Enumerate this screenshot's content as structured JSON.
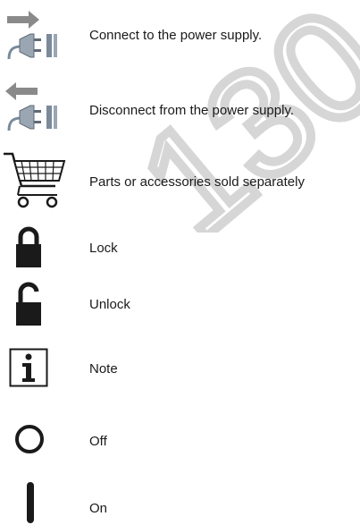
{
  "watermark": {
    "text": "130",
    "color": "#d6d6d6"
  },
  "colors": {
    "ink": "#1a1a1a",
    "arrow": "#8a8a8a",
    "plug": "#7a8a9a"
  },
  "symbols": [
    {
      "icon": "plug-connect-icon",
      "label": "Connect to the power supply."
    },
    {
      "icon": "plug-disconnect-icon",
      "label": "Disconnect from the power supply."
    },
    {
      "icon": "shopping-cart-icon",
      "label": "Parts or accessories sold separately"
    },
    {
      "icon": "lock-icon",
      "label": "Lock"
    },
    {
      "icon": "unlock-icon",
      "label": "Unlock"
    },
    {
      "icon": "info-icon",
      "label": "Note"
    },
    {
      "icon": "power-off-icon",
      "label": "Off"
    },
    {
      "icon": "power-on-icon",
      "label": "On"
    }
  ]
}
